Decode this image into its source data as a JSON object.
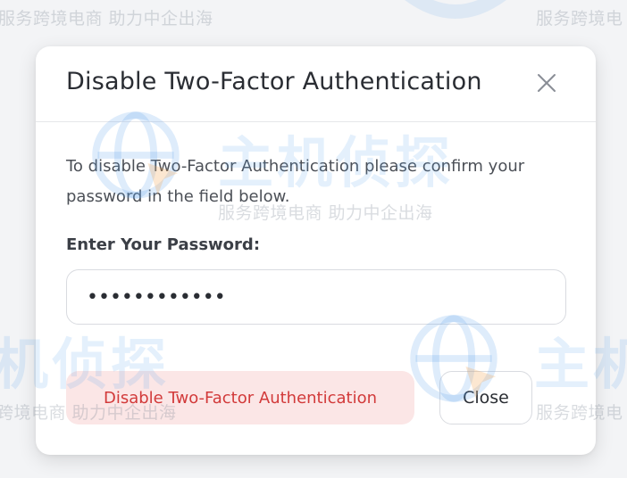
{
  "modal": {
    "title": "Disable Two-Factor Authentication",
    "description": "To disable Two-Factor Authentication please confirm your password in the field below.",
    "password_label": "Enter Your Password:",
    "password_value": "••••••••••••",
    "disable_button_label": "Disable Two-Factor Authentication",
    "close_button_label": "Close"
  },
  "watermark": {
    "tagline": "服务跨境电商 助力中企出海",
    "tagline_short": "服务跨境电",
    "tagline_fragment": "跨境电商 助力中企出海",
    "brand_name": "主机侦探",
    "brand_fragment_left": "机侦探",
    "brand_fragment_right": "主机"
  },
  "colors": {
    "danger_text": "#d23a3a",
    "danger_bg": "#fbe6e6",
    "watermark_blue": "#5aa0eb"
  }
}
